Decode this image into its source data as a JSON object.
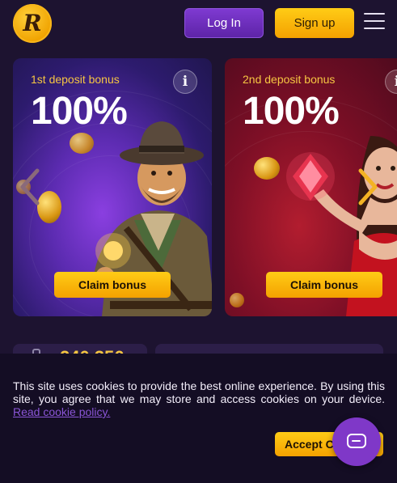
{
  "header": {
    "logo_letter": "R",
    "login_label": "Log In",
    "signup_label": "Sign up"
  },
  "bonus_cards": [
    {
      "subtitle": "1st deposit bonus",
      "value": "100%",
      "claim_label": "Claim bonus",
      "info_label": "i"
    },
    {
      "subtitle": "2nd deposit bonus",
      "value": "100%",
      "claim_label": "Claim bonus",
      "info_label": "i"
    }
  ],
  "jackpot": {
    "value": "240,356"
  },
  "cookie_banner": {
    "text": "This site uses cookies to provide the best online experience. By using this site, you agree that we may store and access cookies on your device.",
    "link_label": "Read cookie policy.",
    "accept_label": "Accept Cookies"
  },
  "icons": {
    "menu": "hamburger-menu-icon",
    "info": "info-icon",
    "prev": "chevron-left-icon",
    "next": "chevron-right-icon",
    "chat": "chat-icon"
  },
  "colors": {
    "background": "#1d1330",
    "accent_gold": "#f4a100",
    "accent_purple": "#7e3ad1"
  }
}
